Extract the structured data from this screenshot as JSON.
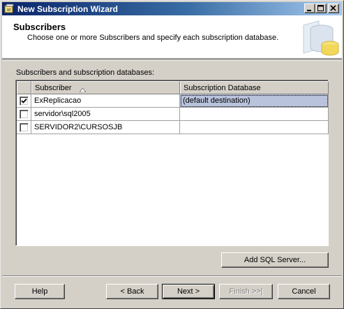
{
  "window": {
    "title": "New Subscription Wizard",
    "title_color_start": "#0a246a",
    "title_color_end": "#a6caf0"
  },
  "header": {
    "title": "Subscribers",
    "subtitle": "Choose one or more Subscribers and specify each subscription database."
  },
  "grid": {
    "label": "Subscribers and subscription databases:",
    "columns": [
      "Subscriber",
      "Subscription Database"
    ],
    "sort_icon": "sort-ascending-icon",
    "rows": [
      {
        "checked": true,
        "subscriber": "ExReplicacao",
        "database": "(default destination)",
        "selected": true
      },
      {
        "checked": false,
        "subscriber": "servidor\\sql2005",
        "database": ""
      },
      {
        "checked": false,
        "subscriber": "SERVIDOR2\\CURSOSJB",
        "database": ""
      }
    ],
    "selected_color": "#b9c3dc"
  },
  "buttons": {
    "add_sql_server": "Add SQL Server...",
    "help": "Help",
    "back": "< Back",
    "next": "Next >",
    "finish": "Finish >>|",
    "cancel": "Cancel"
  },
  "icons": {
    "title": "wizard-app-icon",
    "minimize": "minimize-icon",
    "maximize": "maximize-icon",
    "close": "close-icon",
    "header_art": "database-cylinder-icon"
  }
}
